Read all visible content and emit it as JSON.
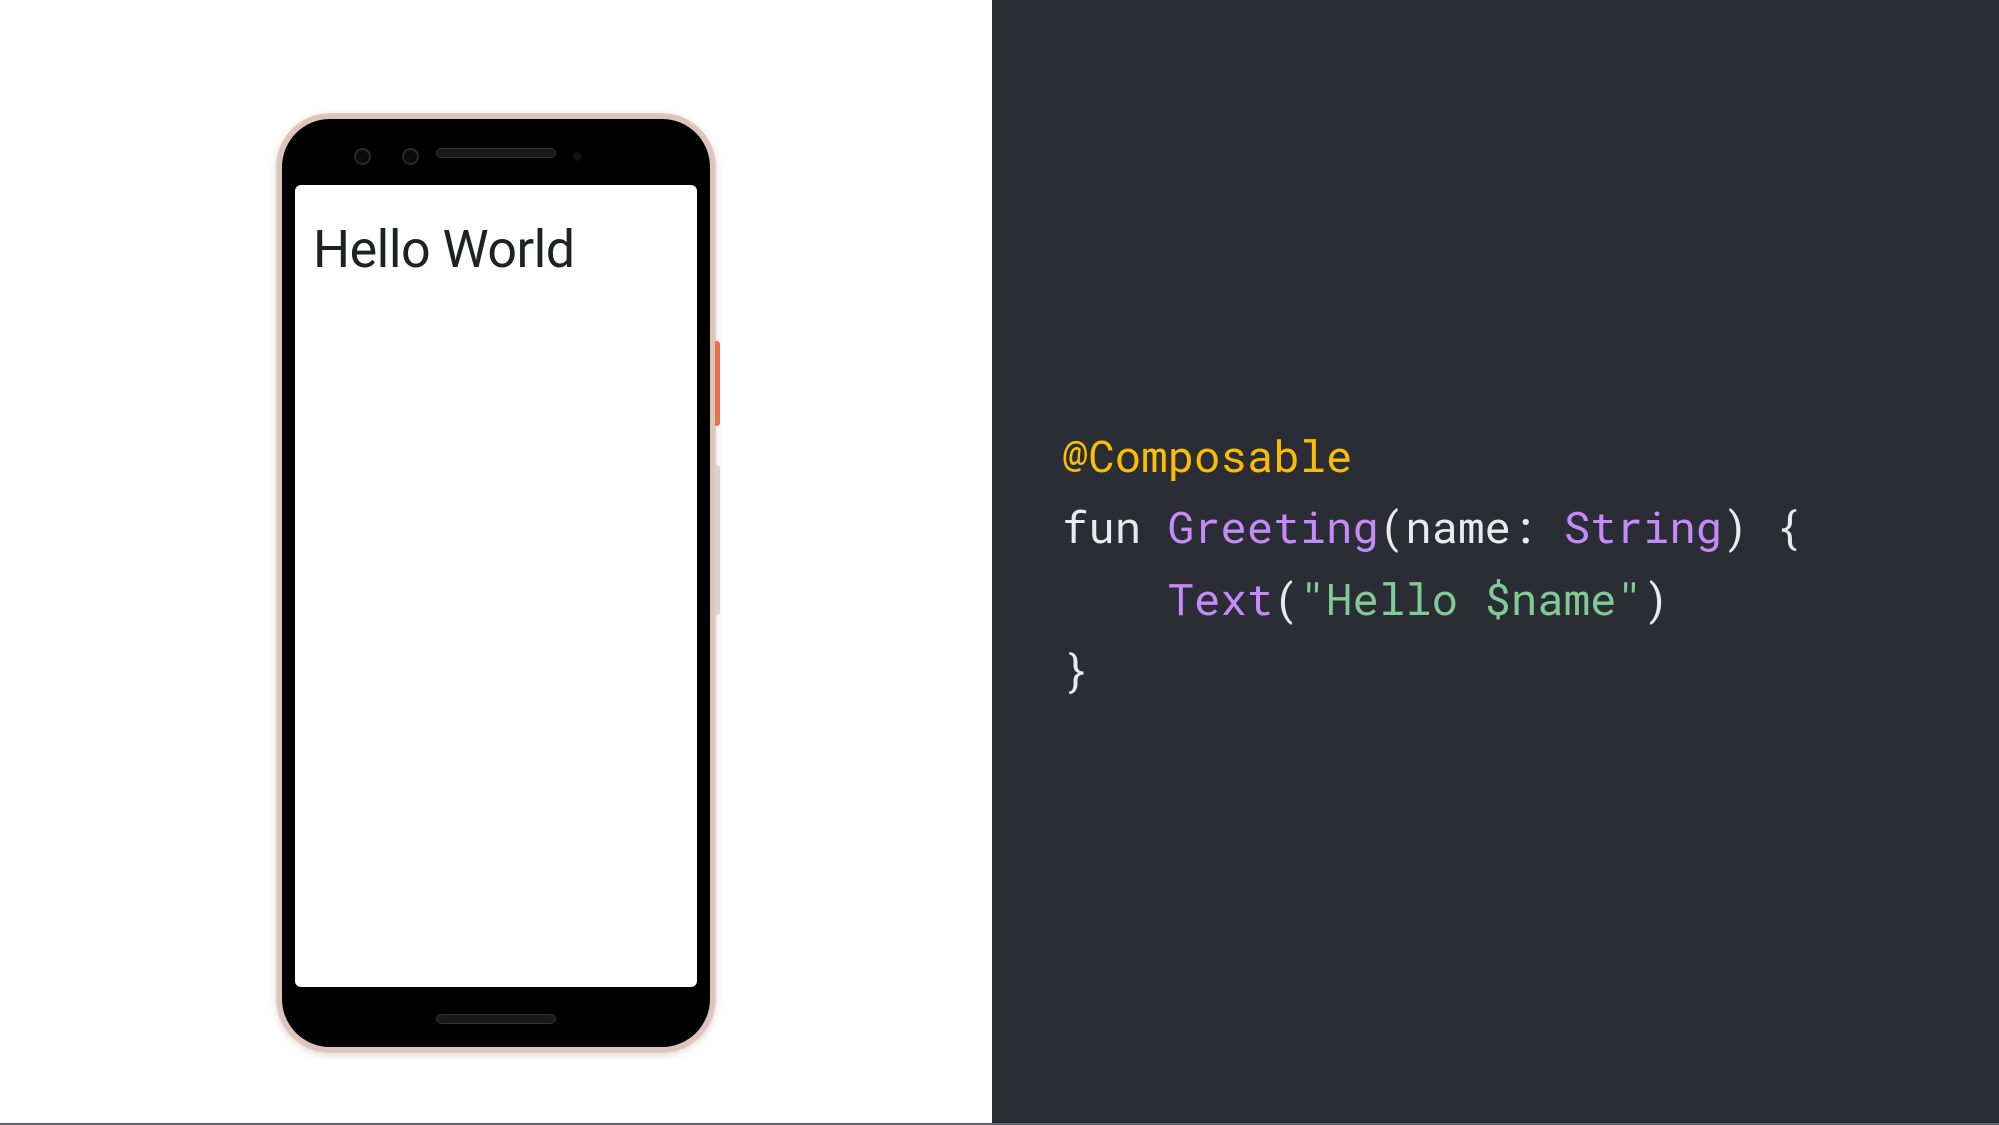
{
  "phone": {
    "screen_text": "Hello World"
  },
  "code": {
    "annotation": "@Composable",
    "fun_keyword": "fun",
    "function_name": "Greeting",
    "open_paren": "(",
    "param_name": "name",
    "colon": ":",
    "param_type": "String",
    "close_paren": ")",
    "open_brace": "{",
    "text_call": "Text",
    "text_open": "(",
    "string_literal": "\"Hello $name\"",
    "text_close": ")",
    "close_brace": "}"
  }
}
